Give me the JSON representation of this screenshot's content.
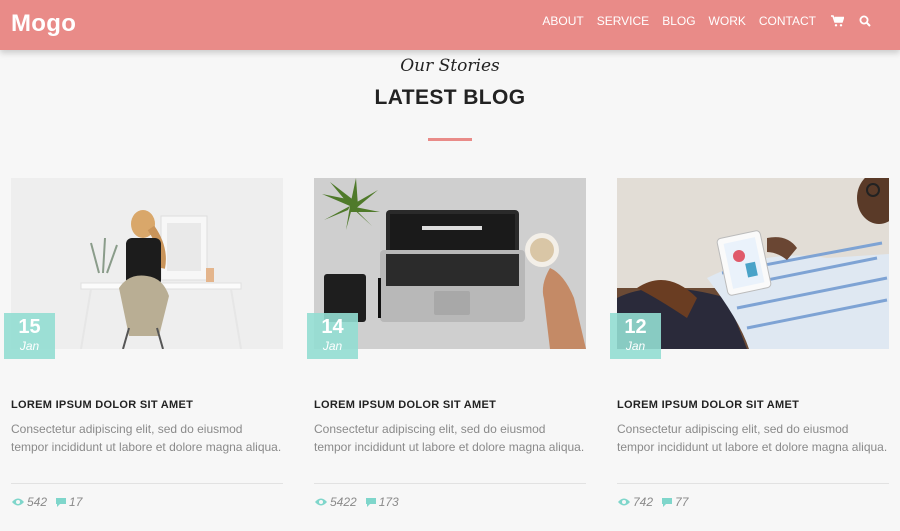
{
  "header": {
    "logo": "Mogo",
    "nav": [
      "ABOUT",
      "SERVICE",
      "BLOG",
      "WORK",
      "CONTACT"
    ],
    "icons": [
      "cart-icon",
      "search-icon"
    ]
  },
  "section": {
    "subtitle": "Our Stories",
    "title": "LATEST BLOG"
  },
  "colors": {
    "brand": "#e98b88",
    "date_badge": "#92ddd1",
    "stat_icon": "#7fd6cb"
  },
  "posts": [
    {
      "day": "15",
      "month": "Jan",
      "title": "LOREM IPSUM DOLOR SIT AMET",
      "text": "Consectetur adipiscing elit, sed do eiusmod tempor incididunt ut labore et dolore magna aliqua.",
      "views": "542",
      "comments": "17"
    },
    {
      "day": "14",
      "month": "Jan",
      "title": "LOREM IPSUM DOLOR SIT AMET",
      "text": "Consectetur adipiscing elit, sed do eiusmod tempor incididunt ut labore et dolore magna aliqua.",
      "views": "5422",
      "comments": "173"
    },
    {
      "day": "12",
      "month": "Jan",
      "title": "LOREM IPSUM DOLOR SIT AMET",
      "text": "Consectetur adipiscing elit, sed do eiusmod tempor incididunt ut labore et dolore magna aliqua.",
      "views": "742",
      "comments": "77"
    }
  ]
}
